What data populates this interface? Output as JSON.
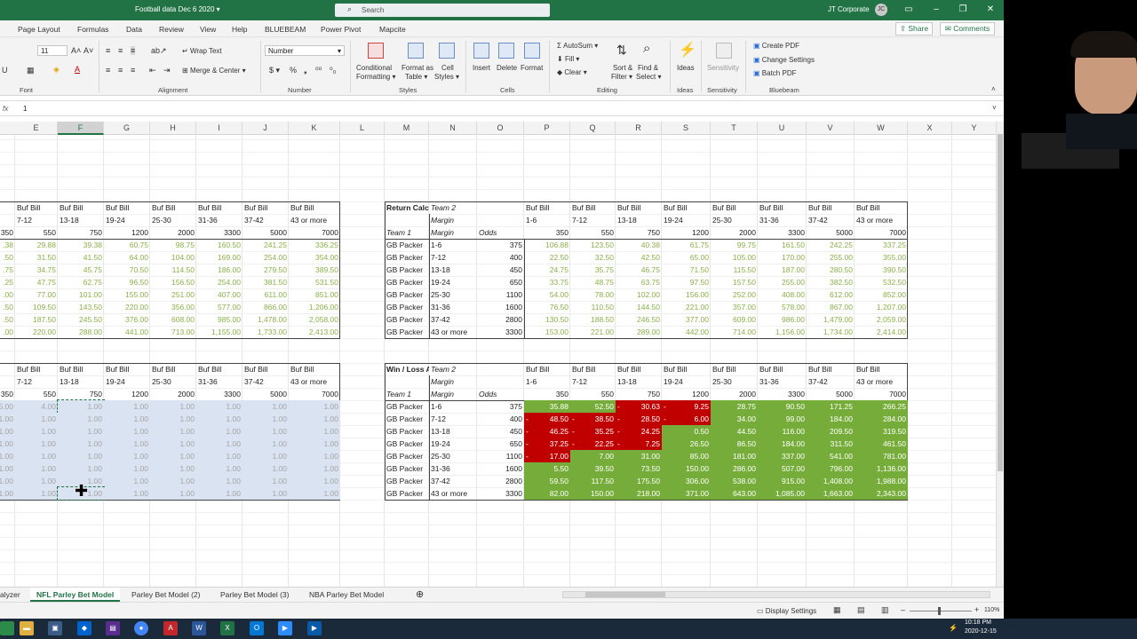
{
  "window": {
    "title": "Football data Dec 6 2020",
    "search_placeholder": "Search",
    "user": "JT Corporate",
    "user_initials": "JC"
  },
  "menu": {
    "items": [
      "Page Layout",
      "Formulas",
      "Data",
      "Review",
      "View",
      "Help",
      "BLUEBEAM",
      "Power Pivot",
      "Mapcite"
    ],
    "share": "Share",
    "comments": "Comments"
  },
  "ribbon": {
    "font": {
      "size": "11",
      "group": "Font"
    },
    "alignment": {
      "wrap": "Wrap Text",
      "merge": "Merge & Center",
      "group": "Alignment"
    },
    "number": {
      "format": "Number",
      "group": "Number"
    },
    "styles": {
      "cond": [
        "Conditional",
        "Formatting"
      ],
      "table": [
        "Format as",
        "Table"
      ],
      "cell": [
        "Cell",
        "Styles"
      ],
      "group": "Styles"
    },
    "cells": {
      "insert": "Insert",
      "delete": "Delete",
      "format": "Format",
      "group": "Cells"
    },
    "editing": {
      "autosum": "AutoSum",
      "fill": "Fill",
      "clear": "Clear",
      "sort": [
        "Sort &",
        "Filter"
      ],
      "find": [
        "Find &",
        "Select"
      ],
      "group": "Editing"
    },
    "ideas": {
      "label": "Ideas",
      "group": "Ideas"
    },
    "sensitivity": {
      "label": "Sensitivity",
      "group": "Sensitivity"
    },
    "bluebeam": {
      "create": "Create PDF",
      "change": "Change Settings",
      "batch": "Batch PDF",
      "group": "Bluebeam"
    }
  },
  "formula_bar": {
    "fx": "fx",
    "value": "1"
  },
  "columns": [
    "E",
    "F",
    "G",
    "H",
    "I",
    "J",
    "K",
    "L",
    "M",
    "N",
    "O",
    "P",
    "Q",
    "R",
    "S",
    "T",
    "U",
    "V",
    "W",
    "X",
    "Y"
  ],
  "left_top": {
    "team2": [
      "Buf Bill",
      "Buf Bill",
      "Buf Bill",
      "Buf Bill",
      "Buf Bill",
      "Buf Bill",
      "Buf Bill"
    ],
    "margin": [
      "7-12",
      "13-18",
      "19-24",
      "25-30",
      "31-36",
      "37-42",
      "43 or more"
    ],
    "odds": [
      "350",
      "550",
      "750",
      "1200",
      "2000",
      "3300",
      "5000",
      "7000"
    ],
    "rows": [
      [
        ".38",
        "29.88",
        "39.38",
        "60.75",
        "98.75",
        "160.50",
        "241.25",
        "336.25"
      ],
      [
        ".50",
        "31.50",
        "41.50",
        "64.00",
        "104.00",
        "169.00",
        "254.00",
        "354.00"
      ],
      [
        ".75",
        "34.75",
        "45.75",
        "70.50",
        "114.50",
        "186.00",
        "279.50",
        "389.50"
      ],
      [
        ".25",
        "47.75",
        "62.75",
        "96.50",
        "156.50",
        "254.00",
        "381.50",
        "531.50"
      ],
      [
        ".00",
        "77.00",
        "101.00",
        "155.00",
        "251.00",
        "407.00",
        "611.00",
        "851.00"
      ],
      [
        ".50",
        "109.50",
        "143.50",
        "220.00",
        "356.00",
        "577.00",
        "866.00",
        "1,206.00"
      ],
      [
        ".50",
        "187.50",
        "245.50",
        "376.00",
        "608.00",
        "985.00",
        "1,478.00",
        "2,058.00"
      ],
      [
        ".00",
        "220.00",
        "288.00",
        "441.00",
        "713.00",
        "1,155.00",
        "1,733.00",
        "2,413.00"
      ]
    ]
  },
  "left_bottom": {
    "team2": [
      "Buf Bill",
      "Buf Bill",
      "Buf Bill",
      "Buf Bill",
      "Buf Bill",
      "Buf Bill",
      "Buf Bill"
    ],
    "margin": [
      "7-12",
      "13-18",
      "19-24",
      "25-30",
      "31-36",
      "37-42",
      "43 or more"
    ],
    "odds": [
      "350",
      "550",
      "750",
      "1200",
      "2000",
      "3300",
      "5000",
      "7000"
    ],
    "rows": [
      [
        "5.00",
        "4.00",
        "1.00",
        "1.00",
        "1.00",
        "1.00",
        "1.00",
        "1.00"
      ],
      [
        "1.00",
        "1.00",
        "1.00",
        "1.00",
        "1.00",
        "1.00",
        "1.00",
        "1.00"
      ],
      [
        "1.00",
        "1.00",
        "1.00",
        "1.00",
        "1.00",
        "1.00",
        "1.00",
        "1.00"
      ],
      [
        "1.00",
        "1.00",
        "1.00",
        "1.00",
        "1.00",
        "1.00",
        "1.00",
        "1.00"
      ],
      [
        "1.00",
        "1.00",
        "1.00",
        "1.00",
        "1.00",
        "1.00",
        "1.00",
        "1.00"
      ],
      [
        "1.00",
        "1.00",
        "1.00",
        "1.00",
        "1.00",
        "1.00",
        "1.00",
        "1.00"
      ],
      [
        "1.00",
        "1.00",
        "1.00",
        "1.00",
        "1.00",
        "1.00",
        "1.00",
        "1.00"
      ],
      [
        "1.00",
        "1.00",
        "1.00",
        "1.00",
        "1.00",
        "1.00",
        "1.00",
        "1.00"
      ]
    ]
  },
  "return_calc": {
    "title": "Return Calculator",
    "team2_label": "Team 2",
    "margin_label": "Margin",
    "team1_label": "Team 1",
    "odds_label": "Odds",
    "team2": [
      "Buf Bill",
      "Buf Bill",
      "Buf Bill",
      "Buf Bill",
      "Buf Bill",
      "Buf Bill",
      "Buf Bill",
      "Buf Bill"
    ],
    "margins": [
      "1-6",
      "7-12",
      "13-18",
      "19-24",
      "25-30",
      "31-36",
      "37-42",
      "43 or more"
    ],
    "odds": [
      "350",
      "550",
      "750",
      "1200",
      "2000",
      "3300",
      "5000",
      "7000"
    ],
    "rows": [
      {
        "team": "GB Packer",
        "margin": "1-6",
        "odds": "375",
        "vals": [
          "106.88",
          "123.50",
          "40.38",
          "61.75",
          "99.75",
          "161.50",
          "242.25",
          "337.25"
        ]
      },
      {
        "team": "GB Packer",
        "margin": "7-12",
        "odds": "400",
        "vals": [
          "22.50",
          "32.50",
          "42.50",
          "65.00",
          "105.00",
          "170.00",
          "255.00",
          "355.00"
        ]
      },
      {
        "team": "GB Packer",
        "margin": "13-18",
        "odds": "450",
        "vals": [
          "24.75",
          "35.75",
          "46.75",
          "71.50",
          "115.50",
          "187.00",
          "280.50",
          "390.50"
        ]
      },
      {
        "team": "GB Packer",
        "margin": "19-24",
        "odds": "650",
        "vals": [
          "33.75",
          "48.75",
          "63.75",
          "97.50",
          "157.50",
          "255.00",
          "382.50",
          "532.50"
        ]
      },
      {
        "team": "GB Packer",
        "margin": "25-30",
        "odds": "1100",
        "vals": [
          "54.00",
          "78.00",
          "102.00",
          "156.00",
          "252.00",
          "408.00",
          "612.00",
          "852.00"
        ]
      },
      {
        "team": "GB Packer",
        "margin": "31-36",
        "odds": "1600",
        "vals": [
          "76.50",
          "110.50",
          "144.50",
          "221.00",
          "357.00",
          "578.00",
          "867.00",
          "1,207.00"
        ]
      },
      {
        "team": "GB Packer",
        "margin": "37-42",
        "odds": "2800",
        "vals": [
          "130.50",
          "188.50",
          "246.50",
          "377.00",
          "609.00",
          "986.00",
          "1,479.00",
          "2,059.00"
        ]
      },
      {
        "team": "GB Packer",
        "margin": "43 or more",
        "odds": "3300",
        "vals": [
          "153.00",
          "221.00",
          "289.00",
          "442.00",
          "714.00",
          "1,156.00",
          "1,734.00",
          "2,414.00"
        ]
      }
    ]
  },
  "win_loss": {
    "title": "Win / Loss Analysis",
    "team2_label": "Team 2",
    "margin_label": "Margin",
    "team1_label": "Team 1",
    "odds_label": "Odds",
    "team2": [
      "Buf Bill",
      "Buf Bill",
      "Buf Bill",
      "Buf Bill",
      "Buf Bill",
      "Buf Bill",
      "Buf Bill",
      "Buf Bill"
    ],
    "margins": [
      "1-6",
      "7-12",
      "13-18",
      "19-24",
      "25-30",
      "31-36",
      "37-42",
      "43 or more"
    ],
    "odds": [
      "350",
      "550",
      "750",
      "1200",
      "2000",
      "3300",
      "5000",
      "7000"
    ],
    "colors": {
      "win": "#76ad3a",
      "loss": "#c00000"
    },
    "rows": [
      {
        "team": "GB Packer",
        "margin": "1-6",
        "odds": "375",
        "vals": [
          "35.88",
          "52.50",
          "-30.63",
          "-9.25",
          "28.75",
          "90.50",
          "171.25",
          "266.25"
        ]
      },
      {
        "team": "GB Packer",
        "margin": "7-12",
        "odds": "400",
        "vals": [
          "-48.50",
          "-38.50",
          "-28.50",
          "-6.00",
          "34.00",
          "99.00",
          "184.00",
          "284.00"
        ]
      },
      {
        "team": "GB Packer",
        "margin": "13-18",
        "odds": "450",
        "vals": [
          "-46.25",
          "-35.25",
          "-24.25",
          "0.50",
          "44.50",
          "116.00",
          "209.50",
          "319.50"
        ]
      },
      {
        "team": "GB Packer",
        "margin": "19-24",
        "odds": "650",
        "vals": [
          "-37.25",
          "-22.25",
          "-7.25",
          "26.50",
          "86.50",
          "184.00",
          "311.50",
          "461.50"
        ]
      },
      {
        "team": "GB Packer",
        "margin": "25-30",
        "odds": "1100",
        "vals": [
          "-17.00",
          "7.00",
          "31.00",
          "85.00",
          "181.00",
          "337.00",
          "541.00",
          "781.00"
        ]
      },
      {
        "team": "GB Packer",
        "margin": "31-36",
        "odds": "1600",
        "vals": [
          "5.50",
          "39.50",
          "73.50",
          "150.00",
          "286.00",
          "507.00",
          "796.00",
          "1,136.00"
        ]
      },
      {
        "team": "GB Packer",
        "margin": "37-42",
        "odds": "2800",
        "vals": [
          "59.50",
          "117.50",
          "175.50",
          "306.00",
          "538.00",
          "915.00",
          "1,408.00",
          "1,988.00"
        ]
      },
      {
        "team": "GB Packer",
        "margin": "43 or more",
        "odds": "3300",
        "vals": [
          "82.00",
          "150.00",
          "218.00",
          "371.00",
          "643.00",
          "1,085.00",
          "1,663.00",
          "2,343.00"
        ]
      }
    ]
  },
  "sheets": {
    "tabs": [
      "alyzer",
      "NFL Parley Bet Model",
      "Parley Bet Model (2)",
      "Parley Bet Model (3)",
      "NBA Parley Bet Model"
    ],
    "active": 1
  },
  "status": {
    "display_settings": "Display Settings",
    "zoom": "110%"
  },
  "taskbar": {
    "time": "10:18 PM",
    "date": "2020-12-15"
  },
  "overlay": {
    "year_partial": "20"
  }
}
